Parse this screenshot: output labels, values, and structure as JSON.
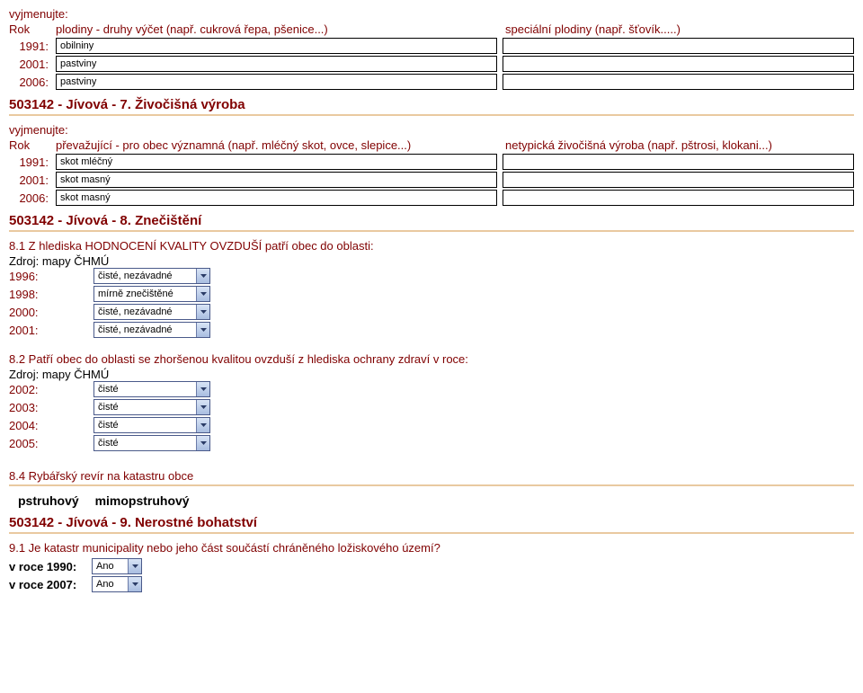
{
  "plodiny": {
    "vyjmenujte": "vyjmenujte:",
    "rok_label": "Rok",
    "col1_header": "plodiny - druhy výčet (např. cukrová řepa, pšenice...)",
    "col2_header": "speciální plodiny (např. šťovík.....)",
    "rows": [
      {
        "year": "1991:",
        "v1": "obilniny",
        "v2": ""
      },
      {
        "year": "2001:",
        "v1": "pastviny",
        "v2": ""
      },
      {
        "year": "2006:",
        "v1": "pastviny",
        "v2": ""
      }
    ]
  },
  "section7": {
    "title": "503142 - Jívová - 7. Živočišná výroba",
    "vyjmenujte": "vyjmenujte:",
    "rok_label": "Rok",
    "col1_header": "převažující - pro obec významná (např. mléčný skot, ovce, slepice...)",
    "col2_header": "netypická živočišná výroba (např. pštrosi, klokani...)",
    "rows": [
      {
        "year": "1991:",
        "v1": "skot mléčný",
        "v2": ""
      },
      {
        "year": "2001:",
        "v1": "skot masný",
        "v2": ""
      },
      {
        "year": "2006:",
        "v1": "skot masný",
        "v2": ""
      }
    ]
  },
  "section8": {
    "title": "503142 - Jívová - 8. Znečištění",
    "q81": "8.1 Z hlediska HODNOCENÍ KVALITY OVZDUŠÍ patří obec do oblasti:",
    "source": "Zdroj: mapy ČHMÚ",
    "rows81": [
      {
        "year": "1996:",
        "val": "čisté, nezávadné"
      },
      {
        "year": "1998:",
        "val": "mírně znečištěné"
      },
      {
        "year": "2000:",
        "val": "čisté, nezávadné"
      },
      {
        "year": "2001:",
        "val": "čisté, nezávadné"
      }
    ],
    "q82": "8.2 Patří obec do oblasti se zhoršenou kvalitou ovzduší z hlediska ochrany zdraví v roce:",
    "rows82": [
      {
        "year": "2002:",
        "val": "čisté"
      },
      {
        "year": "2003:",
        "val": "čisté"
      },
      {
        "year": "2004:",
        "val": "čisté"
      },
      {
        "year": "2005:",
        "val": "čisté"
      }
    ],
    "q84": "8.4 Rybářský revír na katastru obce",
    "opt1": "pstruhový",
    "opt2": "mimopstruhový"
  },
  "section9": {
    "title": "503142 - Jívová - 9. Nerostné bohatství",
    "q91": "9.1 Je katastr municipality nebo jeho část součástí chráněného ložiskového území?",
    "rows": [
      {
        "label": "v roce 1990:",
        "val": "Ano"
      },
      {
        "label": "v roce 2007:",
        "val": "Ano"
      }
    ]
  }
}
